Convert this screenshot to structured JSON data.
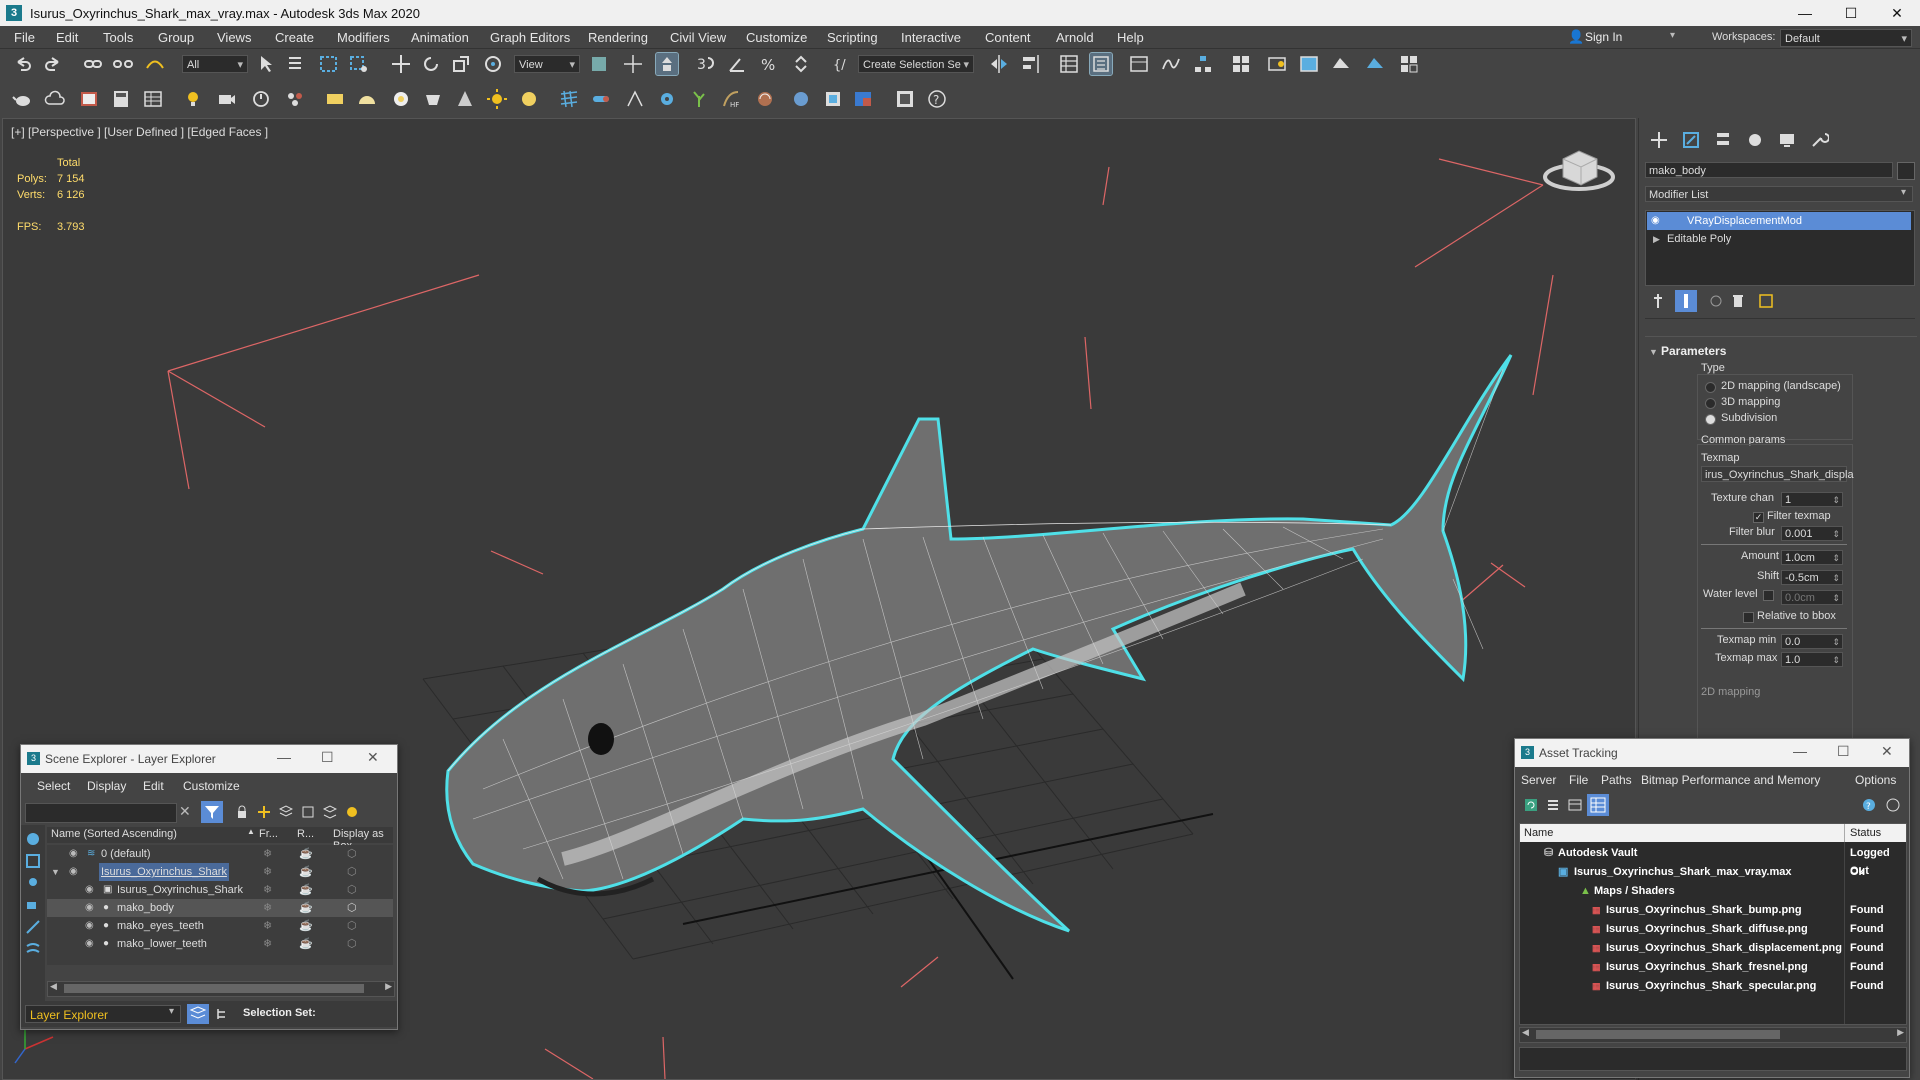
{
  "window": {
    "title": "Isurus_Oxyrinchus_Shark_max_vray.max - Autodesk 3ds Max 2020",
    "app_icon": "3",
    "minimize": "—",
    "maximize": "☐",
    "close": "✕"
  },
  "menu": [
    "File",
    "Edit",
    "Tools",
    "Group",
    "Views",
    "Create",
    "Modifiers",
    "Animation",
    "Graph Editors",
    "Rendering",
    "Civil View",
    "Customize",
    "Scripting",
    "Interactive",
    "Content",
    "Arnold",
    "Help"
  ],
  "signin": {
    "label": "Sign In",
    "workspaces_label": "Workspaces:",
    "workspace_value": "Default"
  },
  "toolbar": {
    "filter_value": "All",
    "view_value": "View",
    "selection_set_placeholder": "Create Selection Se"
  },
  "viewport": {
    "label": "[+] [Perspective ] [User Defined ] [Edged Faces ]",
    "stats": {
      "total_label": "Total",
      "polys_label": "Polys:",
      "polys_value": "7 154",
      "verts_label": "Verts:",
      "verts_value": "6 126",
      "fps_label": "FPS:",
      "fps_value": "3.793"
    }
  },
  "command_panel": {
    "object_name": "mako_body",
    "modifier_list": "Modifier List",
    "stack": [
      "VRayDisplacementMod",
      "Editable Poly"
    ],
    "rollout_title": "Parameters",
    "type_label": "Type",
    "type_options": [
      {
        "label": "2D mapping (landscape)",
        "selected": false
      },
      {
        "label": "3D mapping",
        "selected": false
      },
      {
        "label": "Subdivision",
        "selected": true
      }
    ],
    "common_params_label": "Common params",
    "texmap_label": "Texmap",
    "texmap_value": "irus_Oxyrinchus_Shark_displa",
    "texture_chan_label": "Texture chan",
    "texture_chan_value": "1",
    "filter_texmap_label": "Filter texmap",
    "filter_blur_label": "Filter blur",
    "filter_blur_value": "0.001",
    "amount_label": "Amount",
    "amount_value": "1.0cm",
    "shift_label": "Shift",
    "shift_value": "-0.5cm",
    "water_level_label": "Water level",
    "water_level_value": "0.0cm",
    "relative_bbox_label": "Relative to bbox",
    "texmap_min_label": "Texmap min",
    "texmap_min_value": "0.0",
    "texmap_max_label": "Texmap max",
    "texmap_max_value": "1.0",
    "mapping_2d_label": "2D mapping"
  },
  "scene_explorer": {
    "title": "Scene Explorer - Layer Explorer",
    "menu": [
      "Select",
      "Display",
      "Edit",
      "Customize"
    ],
    "columns": [
      "Name (Sorted Ascending)",
      "Fr...",
      "R...",
      "Display as Box"
    ],
    "rows": [
      {
        "name": "0 (default)",
        "indent": 0
      },
      {
        "name": "Isurus_Oxyrinchus_Shark",
        "indent": 0
      },
      {
        "name": "Isurus_Oxyrinchus_Shark",
        "indent": 1
      },
      {
        "name": "mako_body",
        "indent": 1
      },
      {
        "name": "mako_eyes_teeth",
        "indent": 1
      },
      {
        "name": "mako_lower_teeth",
        "indent": 1
      }
    ],
    "footer_label": "Layer Explorer",
    "selection_set_label": "Selection Set:"
  },
  "asset_tracking": {
    "title": "Asset Tracking",
    "menu": [
      "Server",
      "File",
      "Paths",
      "Bitmap Performance and Memory",
      "Options"
    ],
    "columns": [
      "Name",
      "Status"
    ],
    "rows": [
      {
        "name": "Autodesk Vault",
        "status": "Logged Out"
      },
      {
        "name": "Isurus_Oxyrinchus_Shark_max_vray.max",
        "status": "Ok"
      },
      {
        "name": "Maps / Shaders",
        "status": ""
      },
      {
        "name": "Isurus_Oxyrinchus_Shark_bump.png",
        "status": "Found"
      },
      {
        "name": "Isurus_Oxyrinchus_Shark_diffuse.png",
        "status": "Found"
      },
      {
        "name": "Isurus_Oxyrinchus_Shark_displacement.png",
        "status": "Found"
      },
      {
        "name": "Isurus_Oxyrinchus_Shark_fresnel.png",
        "status": "Found"
      },
      {
        "name": "Isurus_Oxyrinchus_Shark_specular.png",
        "status": "Found"
      }
    ]
  },
  "colors": {
    "accent": "#5aaee0",
    "selection_outline": "#4fe0e8",
    "stats": "#ffdc6b",
    "layer_label": "#f0c020"
  }
}
